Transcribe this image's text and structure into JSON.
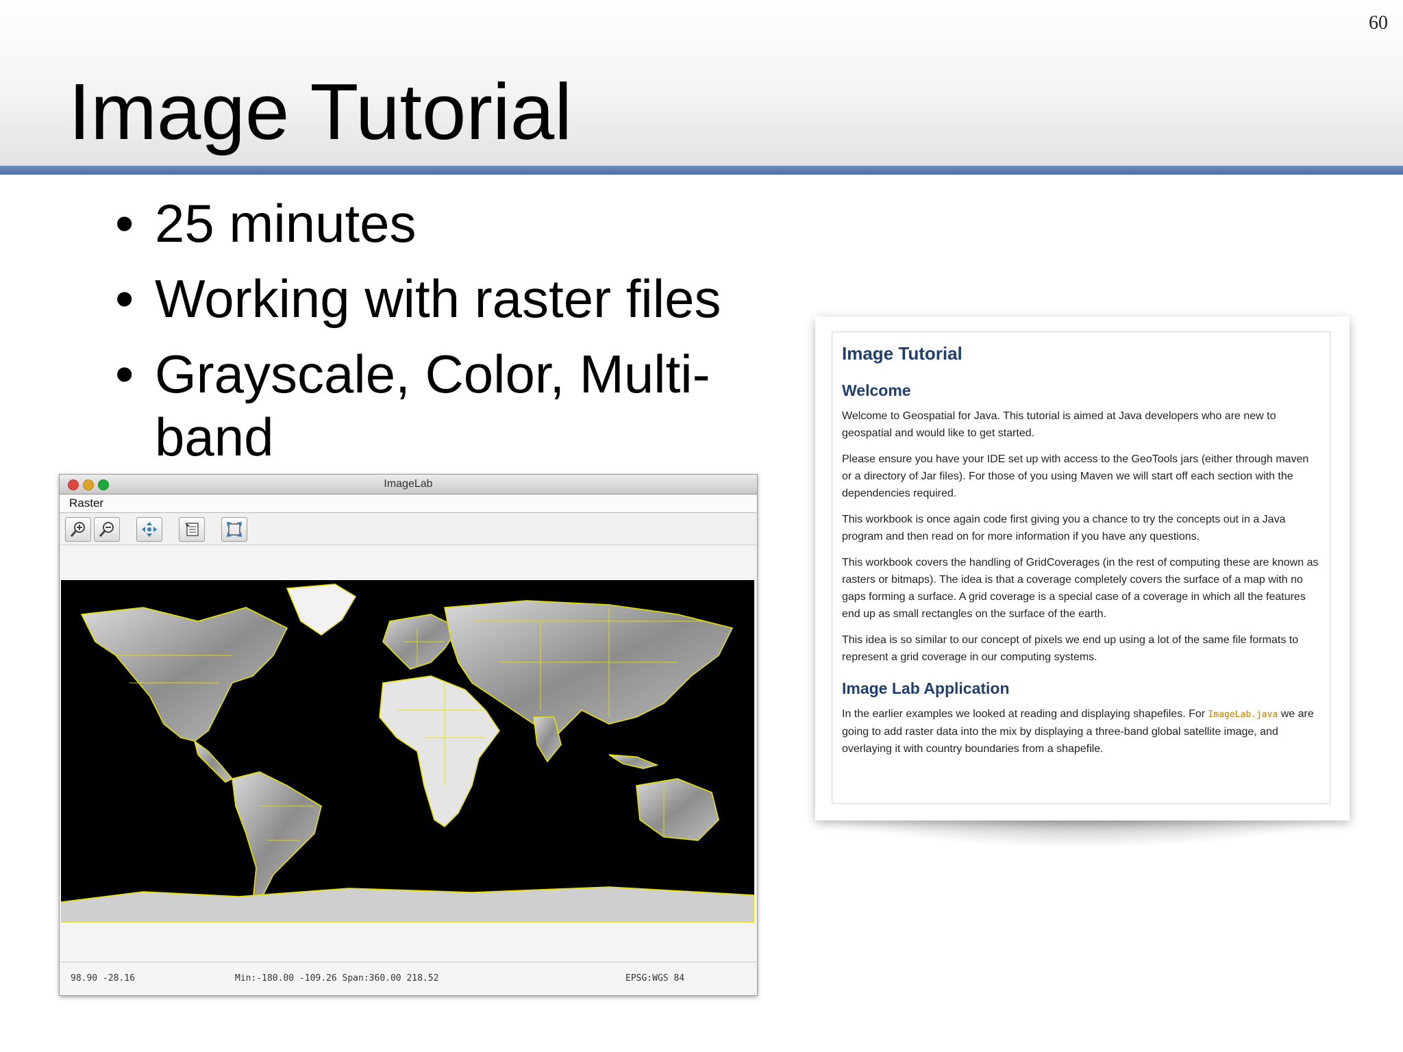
{
  "slide": {
    "page_number": "60",
    "title": "Image Tutorial",
    "bullets": [
      "25 minutes",
      "Working with raster files",
      "Grayscale, Color, Multi-band"
    ]
  },
  "app": {
    "window_title": "ImageLab",
    "menu": [
      "Raster"
    ],
    "toolbar_icons": [
      "zoom-in-icon",
      "zoom-out-icon",
      "pan-icon",
      "info-icon",
      "reset-extent-icon"
    ],
    "status": {
      "coords": "98.90 -28.16",
      "extent": "Min:-180.00 -109.26 Span:360.00 218.52",
      "crs": "EPSG:WGS 84"
    },
    "colors": {
      "boundaries": "#e8e000",
      "map_bg": "#000000"
    }
  },
  "doc": {
    "title": "Image Tutorial",
    "welcome_heading": "Welcome",
    "p1": "Welcome to Geospatial for Java. This tutorial is aimed at Java developers who are new to geospatial and would like to get started.",
    "p2": "Please ensure you have your IDE set up with access to the GeoTools jars (either through maven or a directory of Jar files). For those of you using Maven we will start off each section with the dependencies required.",
    "p3": "This workbook is once again code first giving you a chance to try the concepts out in a Java program and then read on for more information if you have any questions.",
    "p4": "This workbook covers the handling of GridCoverages (in the rest of computing these are known as rasters or bitmaps). The idea is that a coverage completely covers the surface of a map with no gaps forming a surface. A grid coverage is a special case of a coverage in which all the features end up as small rectangles on the surface of the earth.",
    "p5": "This idea is so similar to our concept of pixels we end up using a lot of the same file formats to represent a grid coverage in our computing systems.",
    "app_heading": "Image Lab Application",
    "p6_before": "In the earlier examples we looked at reading and displaying shapefiles. For",
    "p6_link": "ImageLab.java",
    "p6_after": "we are going to add raster data into the mix by displaying a three-band global satellite image, and overlaying it with country boundaries from a shapefile."
  }
}
